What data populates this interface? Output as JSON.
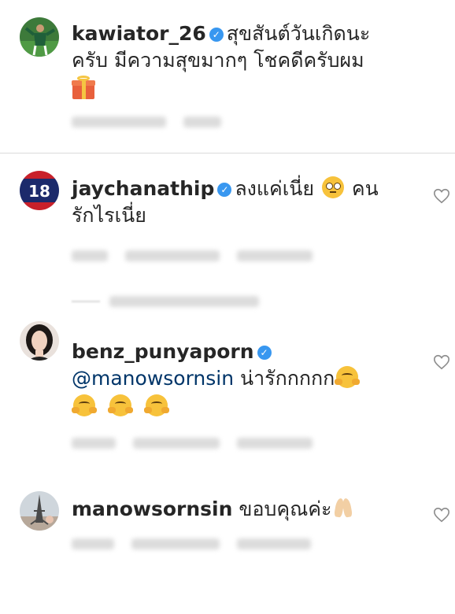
{
  "comments": [
    {
      "username": "kawiator_26",
      "verified": true,
      "text_line1": "สุขสันต์วันเกิดนะ",
      "text_line2": "ครับ มีความสุขมากๆ โชคดีครับผม",
      "avatar": "soccer-player-avatar",
      "emoji": "wrapped-gift-emoji"
    },
    {
      "username": "jaychanathip",
      "verified": true,
      "text_a": "ลงแค่เนี่ย",
      "text_b": "คน",
      "text_line2": "รักไรเนี่ย",
      "avatar": "team-badge-avatar",
      "emoji": "face-rolling-eyes-emoji"
    },
    {
      "username": "benz_punyaporn",
      "verified": true,
      "mention": "@manowsornsin",
      "text": "น่ารักกกกก",
      "avatar": "woman-portrait-avatar",
      "emoji": "hugging-face-emoji"
    },
    {
      "username": "manowsornsin",
      "verified": false,
      "text": "ขอบคุณค่ะ",
      "avatar": "eiffel-tower-avatar",
      "emoji": "folded-hands-emoji"
    }
  ],
  "icons": {
    "verified": "verified-badge-icon",
    "like": "heart-icon"
  },
  "colors": {
    "verified_blue": "#3897f0",
    "mention_blue": "#003569",
    "divider": "#dbdbdb"
  }
}
